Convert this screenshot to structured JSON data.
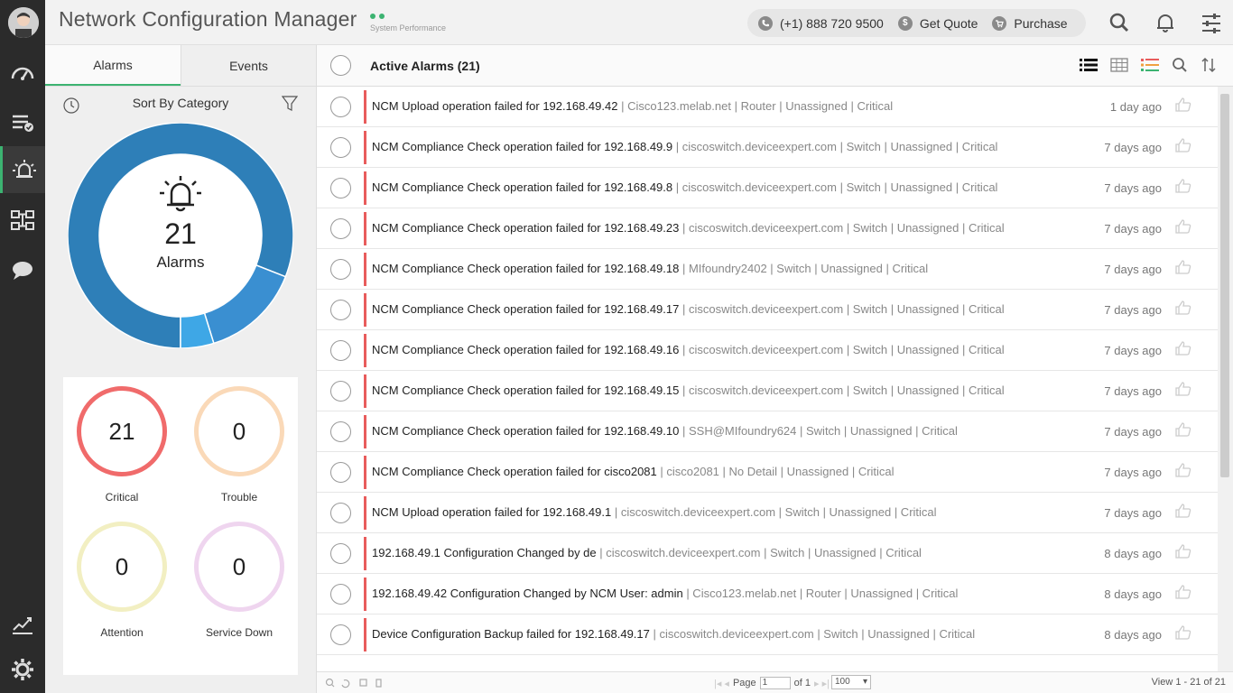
{
  "header": {
    "title": "Network Configuration Manager",
    "perf": "System Performance",
    "phone": "(+1) 888 720 9500",
    "quote": "Get Quote",
    "purchase": "Purchase"
  },
  "tabs": {
    "alarms": "Alarms",
    "events": "Events"
  },
  "sort": {
    "label": "Sort By Category"
  },
  "donut": {
    "count": "21",
    "label": "Alarms",
    "segments": [
      {
        "value": 17,
        "color": "#2e7fb8"
      },
      {
        "value": 3,
        "color": "#3a8fd1"
      },
      {
        "value": 1,
        "color": "#3ea7e6"
      }
    ]
  },
  "stats": [
    {
      "count": "21",
      "label": "Critical",
      "color": "#f06b6b"
    },
    {
      "count": "0",
      "label": "Trouble",
      "color": "#fad9b8"
    },
    {
      "count": "0",
      "label": "Attention",
      "color": "#f2efc2"
    },
    {
      "count": "0",
      "label": "Service Down",
      "color": "#efd5ef"
    }
  ],
  "list": {
    "title": "Active Alarms (21)",
    "rows": [
      {
        "msg": "NCM Upload operation failed for 192.168.49.42",
        "meta": " | Cisco123.melab.net | Router | Unassigned | Critical",
        "time": "1 day ago"
      },
      {
        "msg": "NCM Compliance Check operation failed for 192.168.49.9",
        "meta": " | ciscoswitch.deviceexpert.com | Switch | Unassigned | Critical",
        "time": "7 days ago"
      },
      {
        "msg": "NCM Compliance Check operation failed for 192.168.49.8",
        "meta": " | ciscoswitch.deviceexpert.com | Switch | Unassigned | Critical",
        "time": "7 days ago"
      },
      {
        "msg": "NCM Compliance Check operation failed for 192.168.49.23",
        "meta": " | ciscoswitch.deviceexpert.com | Switch | Unassigned | Critical",
        "time": "7 days ago"
      },
      {
        "msg": "NCM Compliance Check operation failed for 192.168.49.18",
        "meta": " | MIfoundry2402 | Switch | Unassigned | Critical",
        "time": "7 days ago"
      },
      {
        "msg": "NCM Compliance Check operation failed for 192.168.49.17",
        "meta": " | ciscoswitch.deviceexpert.com | Switch | Unassigned | Critical",
        "time": "7 days ago"
      },
      {
        "msg": "NCM Compliance Check operation failed for 192.168.49.16",
        "meta": " | ciscoswitch.deviceexpert.com | Switch | Unassigned | Critical",
        "time": "7 days ago"
      },
      {
        "msg": "NCM Compliance Check operation failed for 192.168.49.15",
        "meta": " | ciscoswitch.deviceexpert.com | Switch | Unassigned | Critical",
        "time": "7 days ago"
      },
      {
        "msg": "NCM Compliance Check operation failed for 192.168.49.10",
        "meta": " | SSH@MIfoundry624 | Switch | Unassigned | Critical",
        "time": "7 days ago"
      },
      {
        "msg": "NCM Compliance Check operation failed for cisco2081",
        "meta": " | cisco2081 | No Detail | Unassigned | Critical",
        "time": "7 days ago"
      },
      {
        "msg": "NCM Upload operation failed for 192.168.49.1",
        "meta": " | ciscoswitch.deviceexpert.com | Switch | Unassigned | Critical",
        "time": "7 days ago"
      },
      {
        "msg": "192.168.49.1 Configuration Changed by de",
        "meta": " | ciscoswitch.deviceexpert.com | Switch | Unassigned | Critical",
        "time": "8 days ago"
      },
      {
        "msg": "192.168.49.42 Configuration Changed by NCM User: admin",
        "meta": " | Cisco123.melab.net | Router | Unassigned | Critical",
        "time": "8 days ago"
      },
      {
        "msg": "Device Configuration Backup failed for 192.168.49.17",
        "meta": " | ciscoswitch.deviceexpert.com | Switch | Unassigned | Critical",
        "time": "8 days ago"
      }
    ]
  },
  "pager": {
    "page_label": "Page",
    "page_value": "1",
    "of_label": "of 1",
    "per_page": "100",
    "view": "View 1 - 21 of 21"
  }
}
